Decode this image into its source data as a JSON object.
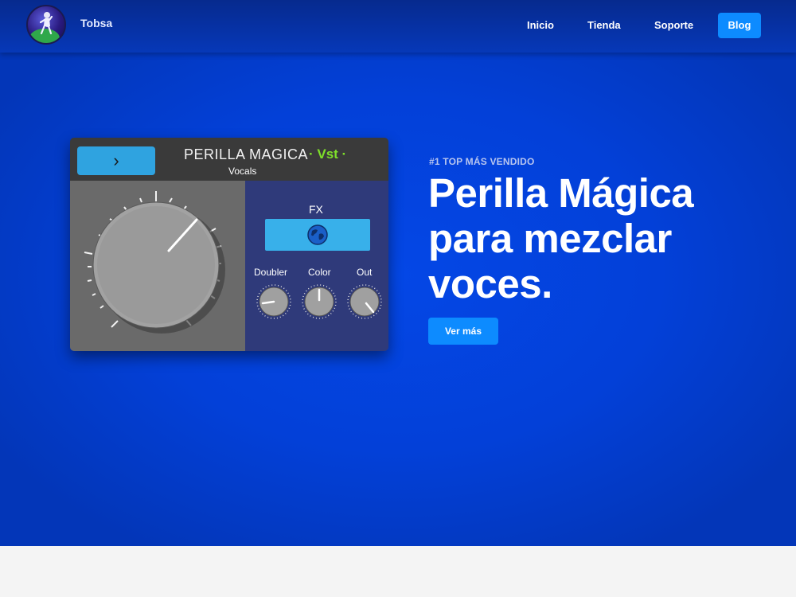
{
  "brand": {
    "name": "Tobsa",
    "logo_icon": "astronaut-logo-icon"
  },
  "nav": {
    "items": [
      {
        "label": "Inicio"
      },
      {
        "label": "Tienda"
      },
      {
        "label": "Soporte"
      }
    ],
    "blog_button": "Blog"
  },
  "plugin": {
    "title": "PERILLA MAGICA",
    "format": "· Vst ·",
    "preset": "Vocals",
    "next_icon": "chevron-right-icon",
    "fx_label": "FX",
    "fx_icon": "globe-icon",
    "knobs": [
      {
        "label": "Doubler"
      },
      {
        "label": "Color"
      },
      {
        "label": "Out"
      }
    ]
  },
  "hero": {
    "eyebrow": "#1 TOP MÁS VENDIDO",
    "headline": "Perilla Mágica para mezclar voces.",
    "cta": "Ver más"
  },
  "colors": {
    "hero_bg": "#0340d8",
    "accent": "#0d8bff",
    "vst_green": "#7fe02a",
    "fx_blue": "#38b0ea"
  }
}
